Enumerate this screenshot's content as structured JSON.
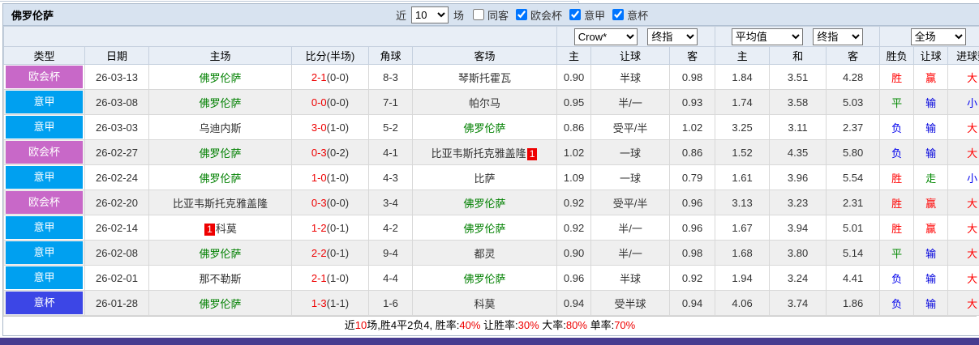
{
  "window": {
    "title": "佛罗伦萨"
  },
  "controls": {
    "recent_prefix": "近",
    "recent_value": "10",
    "recent_suffix": "场",
    "same_away": {
      "label": "同客",
      "checked": false
    },
    "leagues": [
      {
        "label": "欧会杯",
        "checked": true
      },
      {
        "label": "意甲",
        "checked": true
      },
      {
        "label": "意杯",
        "checked": true
      }
    ]
  },
  "header": {
    "company_select": "Crow*",
    "company_time_select": "终指",
    "avg_select": "平均值",
    "avg_time_select": "终指",
    "scope_select": "全场",
    "columns": [
      "类型",
      "日期",
      "主场",
      "比分(半场)",
      "角球",
      "客场",
      "主",
      "让球",
      "客",
      "主",
      "和",
      "客",
      "胜负",
      "让球",
      "进球数"
    ]
  },
  "rows": [
    {
      "league": "欧会杯",
      "date": "26-03-13",
      "home": {
        "name": "佛罗伦萨",
        "green": true
      },
      "score": "2-1",
      "half": "(0-0)",
      "corner": "8-3",
      "away": {
        "name": "琴斯托霍瓦"
      },
      "crown": [
        "0.90",
        "半球",
        "0.98"
      ],
      "avg": [
        "1.84",
        "3.51",
        "4.28"
      ],
      "results": [
        "胜",
        "赢",
        "大"
      ]
    },
    {
      "league": "意甲",
      "date": "26-03-08",
      "home": {
        "name": "佛罗伦萨",
        "green": true
      },
      "score": "0-0",
      "half": "(0-0)",
      "corner": "7-1",
      "away": {
        "name": "帕尔马"
      },
      "crown": [
        "0.95",
        "半/一",
        "0.93"
      ],
      "avg": [
        "1.74",
        "3.58",
        "5.03"
      ],
      "results": [
        "平",
        "输",
        "小"
      ]
    },
    {
      "league": "意甲",
      "date": "26-03-03",
      "home": {
        "name": "乌迪内斯"
      },
      "score": "3-0",
      "half": "(1-0)",
      "corner": "5-2",
      "away": {
        "name": "佛罗伦萨",
        "green": true
      },
      "crown": [
        "0.86",
        "受平/半",
        "1.02"
      ],
      "avg": [
        "3.25",
        "3.11",
        "2.37"
      ],
      "results": [
        "负",
        "输",
        "大"
      ]
    },
    {
      "league": "欧会杯",
      "date": "26-02-27",
      "home": {
        "name": "佛罗伦萨",
        "green": true
      },
      "score": "0-3",
      "half": "(0-2)",
      "corner": "4-1",
      "away": {
        "name": "比亚韦斯托克雅盖隆",
        "badge": "1",
        "badge_pos": "after"
      },
      "crown": [
        "1.02",
        "一球",
        "0.86"
      ],
      "avg": [
        "1.52",
        "4.35",
        "5.80"
      ],
      "results": [
        "负",
        "输",
        "大"
      ]
    },
    {
      "league": "意甲",
      "date": "26-02-24",
      "home": {
        "name": "佛罗伦萨",
        "green": true
      },
      "score": "1-0",
      "half": "(1-0)",
      "corner": "4-3",
      "away": {
        "name": "比萨"
      },
      "crown": [
        "1.09",
        "一球",
        "0.79"
      ],
      "avg": [
        "1.61",
        "3.96",
        "5.54"
      ],
      "results": [
        "胜",
        "走",
        "小"
      ]
    },
    {
      "league": "欧会杯",
      "date": "26-02-20",
      "home": {
        "name": "比亚韦斯托克雅盖隆"
      },
      "score": "0-3",
      "half": "(0-0)",
      "corner": "3-4",
      "away": {
        "name": "佛罗伦萨",
        "green": true
      },
      "crown": [
        "0.92",
        "受平/半",
        "0.96"
      ],
      "avg": [
        "3.13",
        "3.23",
        "2.31"
      ],
      "results": [
        "胜",
        "赢",
        "大"
      ]
    },
    {
      "league": "意甲",
      "date": "26-02-14",
      "home": {
        "name": "科莫",
        "badge": "1",
        "badge_pos": "before"
      },
      "score": "1-2",
      "half": "(0-1)",
      "corner": "4-2",
      "away": {
        "name": "佛罗伦萨",
        "green": true
      },
      "crown": [
        "0.92",
        "半/一",
        "0.96"
      ],
      "avg": [
        "1.67",
        "3.94",
        "5.01"
      ],
      "results": [
        "胜",
        "赢",
        "大"
      ]
    },
    {
      "league": "意甲",
      "date": "26-02-08",
      "home": {
        "name": "佛罗伦萨",
        "green": true
      },
      "score": "2-2",
      "half": "(0-1)",
      "corner": "9-4",
      "away": {
        "name": "都灵"
      },
      "crown": [
        "0.90",
        "半/一",
        "0.98"
      ],
      "avg": [
        "1.68",
        "3.80",
        "5.14"
      ],
      "results": [
        "平",
        "输",
        "大"
      ]
    },
    {
      "league": "意甲",
      "date": "26-02-01",
      "home": {
        "name": "那不勒斯"
      },
      "score": "2-1",
      "half": "(1-0)",
      "corner": "4-4",
      "away": {
        "name": "佛罗伦萨",
        "green": true
      },
      "crown": [
        "0.96",
        "半球",
        "0.92"
      ],
      "avg": [
        "1.94",
        "3.24",
        "4.41"
      ],
      "results": [
        "负",
        "输",
        "大"
      ]
    },
    {
      "league": "意杯",
      "date": "26-01-28",
      "home": {
        "name": "佛罗伦萨",
        "green": true
      },
      "score": "1-3",
      "half": "(1-1)",
      "corner": "1-6",
      "away": {
        "name": "科莫"
      },
      "crown": [
        "0.94",
        "受半球",
        "0.94"
      ],
      "avg": [
        "4.06",
        "3.74",
        "1.86"
      ],
      "results": [
        "负",
        "输",
        "大"
      ]
    }
  ],
  "summary": {
    "segments": [
      {
        "t": "近"
      },
      {
        "t": "10",
        "red": true
      },
      {
        "t": "场,胜4平2负4, 胜率:"
      },
      {
        "t": "40%",
        "red": true
      },
      {
        "t": " 让胜率:"
      },
      {
        "t": "30%",
        "red": true
      },
      {
        "t": " 大率:"
      },
      {
        "t": "80%",
        "red": true
      },
      {
        "t": " 单率:"
      },
      {
        "t": "70%",
        "red": true
      }
    ]
  },
  "colors": {
    "league": {
      "欧会杯": "#c868c8",
      "意甲": "#00a0f0",
      "意杯": "#3c46e6"
    },
    "result": {
      "胜": "#ff0000",
      "平": "#008800",
      "负": "#0000ee",
      "赢": "#ff0000",
      "输": "#0000dd",
      "走": "#008800",
      "大": "#ff0000",
      "小": "#0000ee"
    },
    "team_highlight": "#008000",
    "score": "#ee0000",
    "red_badge_bg": "#ee0000",
    "accent_bar": "#473c90"
  }
}
